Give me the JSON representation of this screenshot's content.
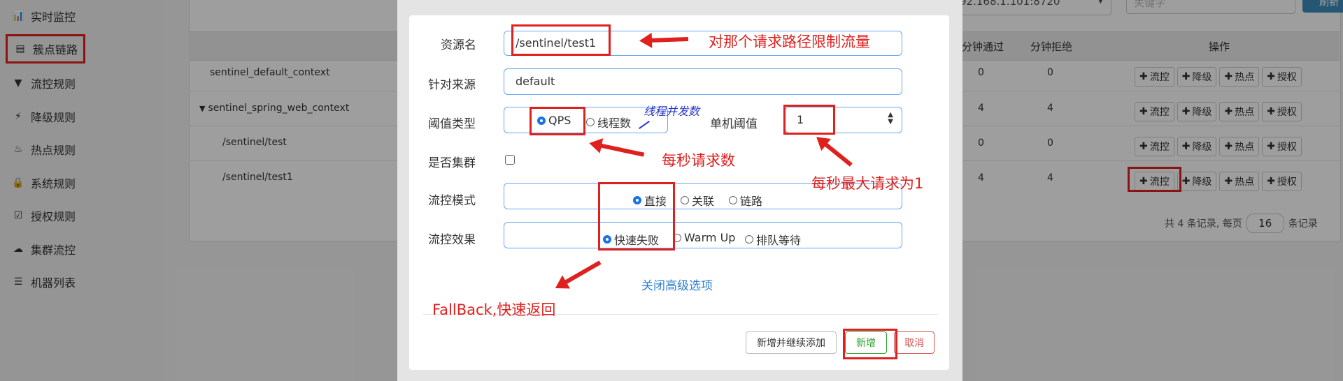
{
  "sidebar": {
    "items": [
      {
        "label": "实时监控",
        "icon": "bar-chart-icon"
      },
      {
        "label": "簇点链路",
        "icon": "list-icon"
      },
      {
        "label": "流控规则",
        "icon": "filter-icon"
      },
      {
        "label": "降级规则",
        "icon": "bolt-icon"
      },
      {
        "label": "热点规则",
        "icon": "fire-icon"
      },
      {
        "label": "系统规则",
        "icon": "lock-icon"
      },
      {
        "label": "授权规则",
        "icon": "check-circle-icon"
      },
      {
        "label": "集群流控",
        "icon": "cloud-icon"
      },
      {
        "label": "机器列表",
        "icon": "list-bullets-icon"
      }
    ]
  },
  "toolbar": {
    "ip_value": "92.168.1.101:8720",
    "keyword_placeholder": "关键字",
    "refresh_label": "刷新"
  },
  "table": {
    "headers": {
      "pass_min": "分钟通过",
      "block_min": "分钟拒绝",
      "ops": "操作"
    },
    "rows": [
      {
        "name": "sentinel_default_context",
        "pass": "0",
        "block": "0"
      },
      {
        "name": "sentinel_spring_web_context",
        "pass": "4",
        "block": "4",
        "expand": "▼"
      },
      {
        "name": "/sentinel/test",
        "pass": "0",
        "block": "0"
      },
      {
        "name": "/sentinel/test1",
        "pass": "4",
        "block": "4"
      }
    ],
    "ops": [
      {
        "icon": "plus-icon",
        "label": "流控"
      },
      {
        "icon": "plus-icon",
        "label": "降级"
      },
      {
        "icon": "plus-icon",
        "label": "热点"
      },
      {
        "icon": "plus-icon",
        "label": "授权"
      }
    ],
    "pager": {
      "prefix": "共 4 条记录, 每页",
      "page_size": "16",
      "suffix": "条记录"
    }
  },
  "modal": {
    "resource_label": "资源名",
    "resource_value": "/sentinel/test1",
    "source_label": "针对来源",
    "source_value": "default",
    "threshold_type_label": "阈值类型",
    "threshold_type_options": [
      "QPS",
      "线程数"
    ],
    "threshold_type_selected": "QPS",
    "single_threshold_label": "单机阈值",
    "single_threshold_value": "1",
    "cluster_label": "是否集群",
    "cluster_checked": false,
    "mode_label": "流控模式",
    "mode_options": [
      "直接",
      "关联",
      "链路"
    ],
    "mode_selected": "直接",
    "effect_label": "流控效果",
    "effect_options": [
      "快速失败",
      "Warm Up",
      "排队等待"
    ],
    "effect_selected": "快速失败",
    "advanced_link": "关闭高级选项",
    "buttons": {
      "add_continue": "新增并继续添加",
      "add": "新增",
      "cancel": "取消"
    }
  },
  "annotations": {
    "resource_note": "对那个请求路径限制流量",
    "thread_note": "线程并发数",
    "qps_note": "每秒请求数",
    "max_note": "每秒最大请求为1",
    "fallback_note": "FallBack,快速返回"
  },
  "colors": {
    "annotation_red": "#e0201d",
    "accent_blue": "#1a73e8",
    "input_border": "#6aa7ef",
    "add_green": "#2ca02c",
    "cancel_red": "#d9534f",
    "note_blue": "#2636c8"
  }
}
